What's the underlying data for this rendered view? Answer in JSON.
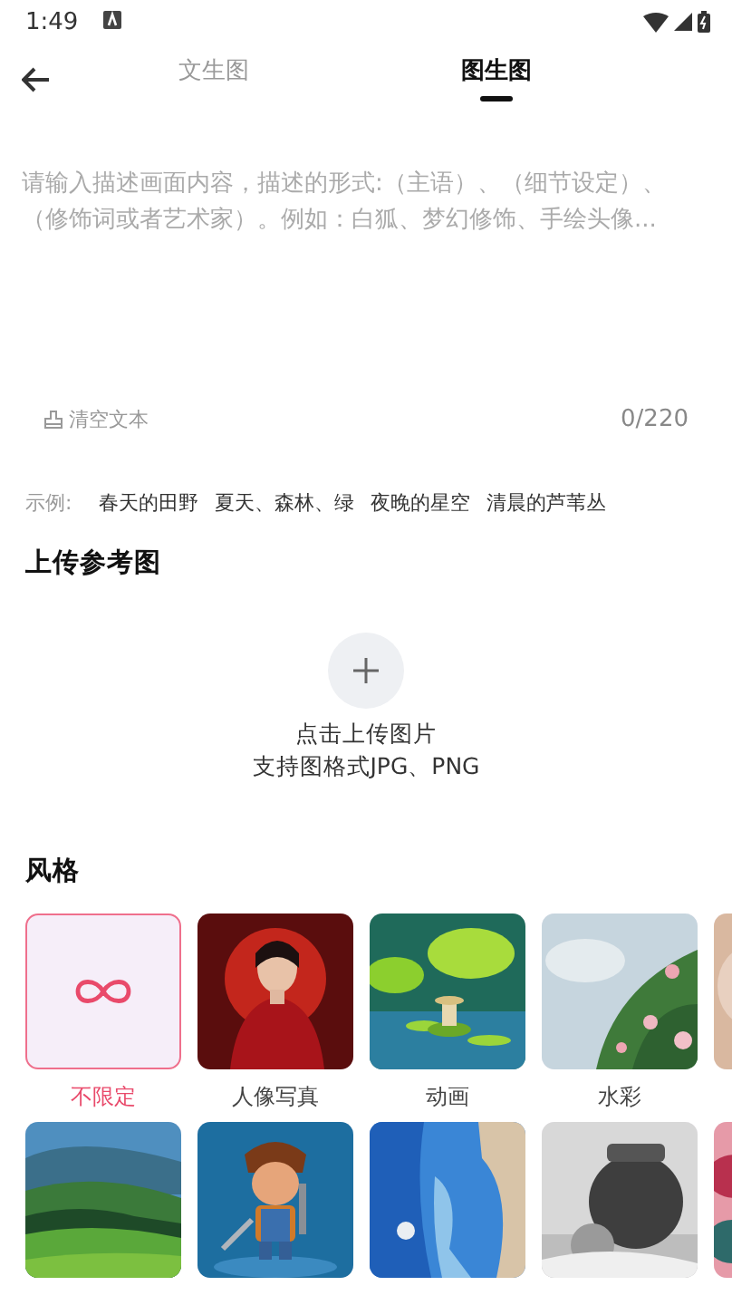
{
  "status_bar": {
    "time": "1:49"
  },
  "tabs": [
    {
      "label": "文生图",
      "selected": false
    },
    {
      "label": "图生图",
      "selected": true
    }
  ],
  "prompt": {
    "placeholder": "请输入描述画面内容，描述的形式:（主语）、（细节设定）、（修饰词或者艺术家）。例如：白狐、梦幻修饰、手绘头像...",
    "clear_label": "清空文本",
    "counter": "0/220"
  },
  "examples": {
    "label": "示例:",
    "items": [
      "春天的田野",
      "夏天、森林、绿",
      "夜晚的星空",
      "清晨的芦苇丛"
    ]
  },
  "upload": {
    "title": "上传参考图",
    "hint": "点击上传图片",
    "formats": "支持图格式JPG、PNG"
  },
  "styles": {
    "title": "风格",
    "items": [
      {
        "kind": "none",
        "label": "不限定",
        "selected": true
      },
      {
        "kind": "picture",
        "label": "人像写真",
        "selected": false
      },
      {
        "kind": "picture",
        "label": "动画",
        "selected": false
      },
      {
        "kind": "picture",
        "label": "水彩",
        "selected": false
      },
      {
        "kind": "picture",
        "selected": false
      },
      {
        "kind": "picture",
        "selected": false
      },
      {
        "kind": "picture",
        "selected": false
      },
      {
        "kind": "picture",
        "selected": false
      },
      {
        "kind": "picture",
        "selected": false
      },
      {
        "kind": "picture",
        "selected": false
      }
    ]
  }
}
